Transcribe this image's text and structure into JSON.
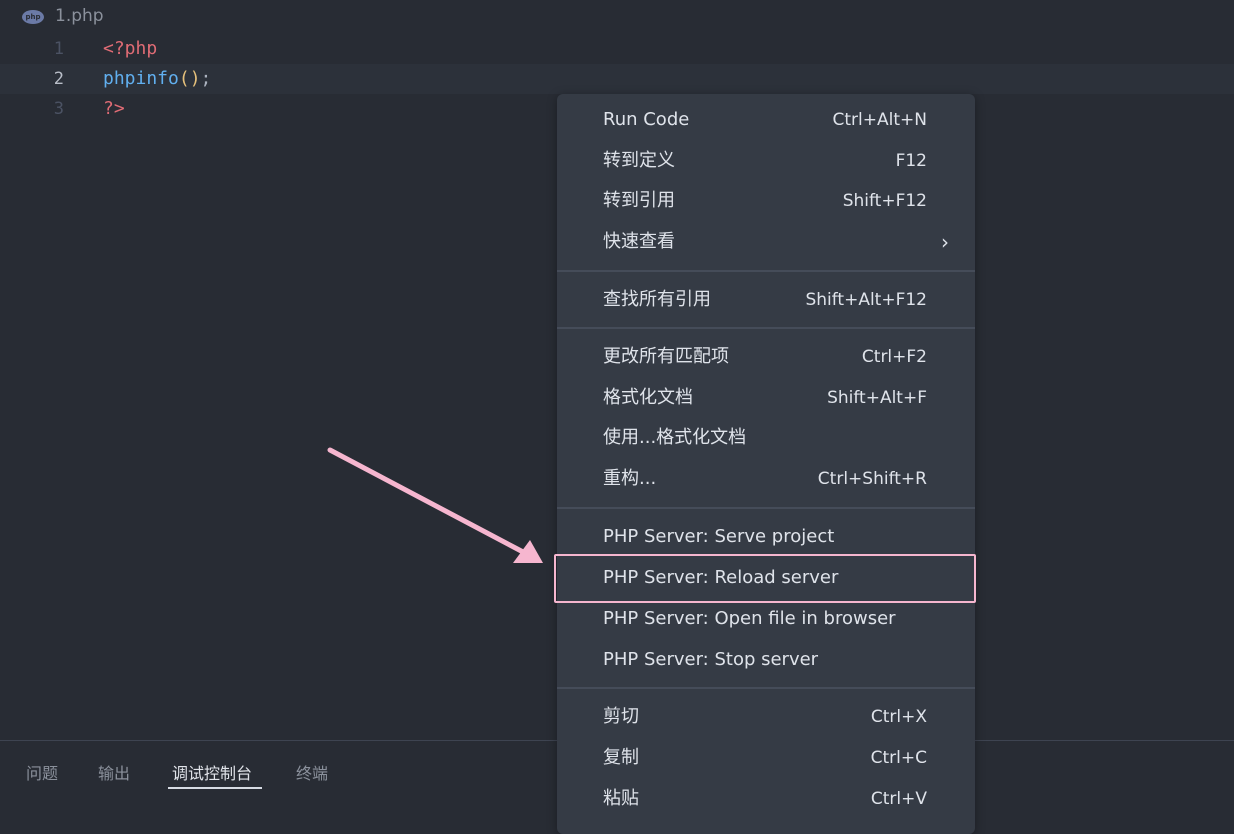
{
  "tab": {
    "filename": "1.php",
    "icon": "php-file-icon",
    "icon_text": "php"
  },
  "editor": {
    "lines": [
      {
        "number": "1",
        "code": "<?php"
      },
      {
        "number": "2",
        "code": "phpinfo();"
      },
      {
        "number": "3",
        "code": "?>"
      }
    ]
  },
  "panel": {
    "tabs": [
      "问题",
      "输出",
      "调试控制台",
      "终端"
    ],
    "active_tab": "调试控制台"
  },
  "context_menu": {
    "items": [
      {
        "label": "Run Code",
        "shortcut": "Ctrl+Alt+N"
      },
      {
        "label": "转到定义",
        "shortcut": "F12"
      },
      {
        "label": "转到引用",
        "shortcut": "Shift+F12"
      },
      {
        "label": "快速查看",
        "shortcut": "",
        "submenu_icon": "chevron-right-icon"
      },
      {
        "label": "查找所有引用",
        "shortcut": "Shift+Alt+F12"
      },
      {
        "label": "更改所有匹配项",
        "shortcut": "Ctrl+F2"
      },
      {
        "label": "格式化文档",
        "shortcut": "Shift+Alt+F"
      },
      {
        "label": "使用...格式化文档",
        "shortcut": ""
      },
      {
        "label": "重构...",
        "shortcut": "Ctrl+Shift+R"
      },
      {
        "label": "PHP Server: Serve project",
        "shortcut": ""
      },
      {
        "label": "PHP Server: Reload server",
        "shortcut": ""
      },
      {
        "label": "PHP Server: Open file in browser",
        "shortcut": ""
      },
      {
        "label": "PHP Server: Stop server",
        "shortcut": ""
      },
      {
        "label": "剪切",
        "shortcut": "Ctrl+X"
      },
      {
        "label": "复制",
        "shortcut": "Ctrl+C"
      },
      {
        "label": "粘贴",
        "shortcut": "Ctrl+V"
      }
    ],
    "highlighted_item": "PHP Server: Reload server"
  },
  "annotation": {
    "arrow_color": "#f6b6cf",
    "highlight_color": "#f6b6cf"
  }
}
